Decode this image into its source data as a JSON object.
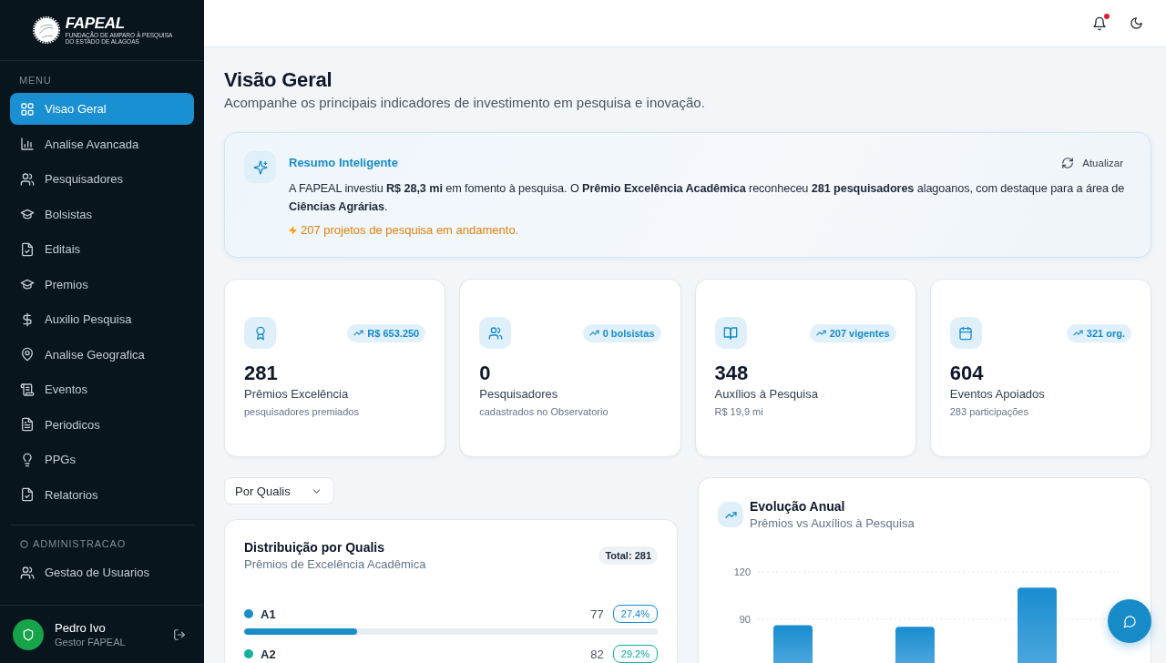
{
  "sidebar": {
    "logo": {
      "name": "FAPEAL",
      "tagline": [
        "FUNDAÇÃO DE AMPARO À PESQUISA",
        "DO ESTADO DE ALAGOAS"
      ]
    },
    "menu": {
      "label": "MENU",
      "items": [
        {
          "label": "Visao Geral",
          "selected": true
        },
        {
          "label": "Analise Avancada",
          "selected": false
        },
        {
          "label": "Pesquisadores",
          "selected": false
        },
        {
          "label": "Bolsistas",
          "selected": false
        },
        {
          "label": "Editais",
          "selected": false
        },
        {
          "label": "Premios",
          "selected": false
        },
        {
          "label": "Auxilio Pesquisa",
          "selected": false
        },
        {
          "label": "Analise Geografica",
          "selected": false
        },
        {
          "label": "Eventos",
          "selected": false
        },
        {
          "label": "Periodicos",
          "selected": false
        },
        {
          "label": "PPGs",
          "selected": false
        },
        {
          "label": "Relatorios",
          "selected": false
        }
      ]
    },
    "admin": {
      "label": "ADMINISTRACAO",
      "items": [
        {
          "label": "Gestao de Usuarios",
          "selected": false
        }
      ]
    },
    "user": {
      "name": "Pedro Ivo",
      "role": "Gestor FAPEAL"
    }
  },
  "header": {
    "notifications": {
      "unread": true
    }
  },
  "page": {
    "title": "Visão Geral",
    "subtitle": "Acompanhe os principais indicadores de investimento em pesquisa e inovação."
  },
  "summary": {
    "title": "Resumo Inteligente",
    "action": "Atualizar",
    "text": "A FAPEAL investiu **R$ 28,3 mi** em fomento à pesquisa. O **Prêmio Excelência Acadêmica** reconheceu **281 pesquisadores** alagoanos, com destaque para a área de **Ciências Agrárias**.",
    "highlight": "207 projetos de pesquisa em andamento."
  },
  "stats": [
    {
      "value": "281",
      "label": "Prêmios Excelência",
      "detail": "pesquisadores premiados",
      "trend": "R$ 653.250"
    },
    {
      "value": "0",
      "label": "Pesquisadores",
      "detail": "cadastrados no Observatorio",
      "trend": "0 bolsistas"
    },
    {
      "value": "348",
      "label": "Auxílios à Pesquisa",
      "detail": "R$ 19,9 mi",
      "trend": "207 vigentes"
    },
    {
      "value": "604",
      "label": "Eventos Apoiados",
      "detail": "283 participações",
      "trend": "321 org."
    }
  ],
  "filter": {
    "value": "Por Qualis"
  },
  "distribution": {
    "title": "Distribuição por Qualis",
    "subtitle": "Prêmios de Excelência Acadêmica",
    "total": "Total: 281",
    "rows": [
      {
        "label": "A1",
        "count": "77",
        "share": "27.4%",
        "level": 0.274,
        "color": "#1a8ccc"
      },
      {
        "label": "A2",
        "count": "82",
        "share": "29.2%",
        "color": "#16b09c"
      }
    ]
  },
  "evolution": {
    "title": "Evolução Anual",
    "subtitle": "Prêmios vs Auxílios à Pesquisa",
    "chart_data": {
      "type": "bar",
      "ylim": [
        62,
        120
      ],
      "yticks": [
        90,
        120
      ],
      "values": [
        86,
        85,
        110
      ]
    }
  }
}
